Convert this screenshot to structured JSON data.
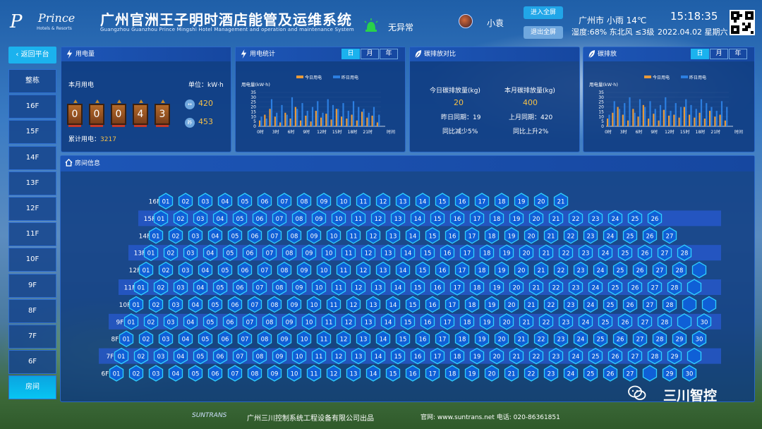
{
  "header": {
    "logo_mark": "P",
    "logo_brand": "Prince",
    "logo_sub": "Hotels & Resorts",
    "title": "广州官洲王子明时酒店能管及运维系统",
    "subtitle": "Guangzhou Guanzhou Prince Mingshi Hotel Management and operation and maintenance System",
    "status": "无异常",
    "username": "小袁",
    "enter_fullscreen": "进入全屏",
    "exit_fullscreen": "退出全屏",
    "weather_line1": "广州市 小雨 14℃",
    "weather_line2": "湿度:68% 东北风 ≤3级",
    "time": "15:18:35",
    "date": "2022.04.02 星期六"
  },
  "sidebar": {
    "back": "返回平台",
    "items": [
      "整栋",
      "16F",
      "15F",
      "14F",
      "13F",
      "12F",
      "11F",
      "10F",
      "9F",
      "8F",
      "7F",
      "6F",
      "房间"
    ],
    "active_index": 12
  },
  "power": {
    "title": "用电量",
    "month_label": "本月用电",
    "unit_label": "单位：kW·h",
    "digits": [
      "0",
      "0",
      "0",
      "4",
      "3"
    ],
    "total_label": "累计用电：",
    "total_value": "3217",
    "badge1": "↔",
    "badge2": "昨",
    "value1": "420",
    "value2": "453"
  },
  "stats": {
    "title": "用电统计",
    "tabs": [
      "日",
      "月",
      "年"
    ],
    "active_tab": 0
  },
  "carbon_compare": {
    "title": "碳排放对比",
    "today_label": "今日碳排放量(kg)",
    "month_label": "本月碳排放量(kg)",
    "today_value": "20",
    "month_value": "400",
    "yesterday_label": "昨日同期：19",
    "lastmonth_label": "上月同期：420",
    "yoy_down": "同比减少5%",
    "yoy_up": "同比上升2%"
  },
  "carbon": {
    "title": "碳排放",
    "tabs": [
      "日",
      "月",
      "年"
    ],
    "active_tab": 0
  },
  "chart_data": [
    {
      "type": "bar",
      "ylabel": "用电量(kW·h)",
      "xlabel": "时间",
      "ylim": [
        0,
        35
      ],
      "yticks": [
        "35",
        "30",
        "25",
        "20",
        "15",
        "10",
        "5",
        "0"
      ],
      "xticks": [
        "0时",
        "3时",
        "6时",
        "9时",
        "12时",
        "15时",
        "18时",
        "21时"
      ],
      "series": [
        {
          "name": "今日用电",
          "color": "#e89a3a",
          "values": [
            6,
            12,
            18,
            10,
            4,
            14,
            8,
            20,
            6,
            11,
            5,
            16,
            9,
            13,
            7,
            18,
            10,
            8,
            12,
            6,
            15,
            9,
            11,
            4
          ]
        },
        {
          "name": "昨日用电",
          "color": "#2c7ee0",
          "values": [
            10,
            8,
            28,
            14,
            22,
            12,
            30,
            18,
            24,
            16,
            20,
            26,
            14,
            28,
            22,
            18,
            24,
            16,
            26,
            20,
            18,
            14,
            20,
            12
          ]
        }
      ]
    },
    {
      "type": "bar",
      "ylabel": "用电量(kW·h)",
      "xlabel": "时间",
      "ylim": [
        0,
        35
      ],
      "yticks": [
        "35",
        "30",
        "25",
        "20",
        "15",
        "10",
        "5",
        "0"
      ],
      "xticks": [
        "0时",
        "3时",
        "6时",
        "9时",
        "12时",
        "15时",
        "18时",
        "21时"
      ],
      "series": [
        {
          "name": "今日用电",
          "color": "#e89a3a",
          "values": [
            8,
            14,
            20,
            12,
            6,
            18,
            10,
            22,
            8,
            13,
            6,
            17,
            11,
            12,
            9,
            20,
            12,
            9,
            14,
            8,
            16,
            10,
            12,
            6
          ]
        },
        {
          "name": "昨日用电",
          "color": "#2c7ee0",
          "values": [
            12,
            26,
            18,
            24,
            30,
            14,
            28,
            20,
            26,
            18,
            22,
            30,
            16,
            24,
            20,
            28,
            22,
            18,
            28,
            24,
            20,
            16,
            26,
            20
          ]
        }
      ]
    }
  ],
  "rooms": {
    "title": "房间信息",
    "floors": [
      {
        "label": "16F",
        "rooms": [
          "01",
          "02",
          "03",
          "04",
          "05",
          "06",
          "07",
          "08",
          "09",
          "10",
          "11",
          "12",
          "13",
          "14",
          "15",
          "16",
          "17",
          "18",
          "19",
          "20",
          "21"
        ]
      },
      {
        "label": "15F",
        "rooms": [
          "01",
          "02",
          "03",
          "04",
          "05",
          "06",
          "07",
          "08",
          "09",
          "10",
          "11",
          "12",
          "13",
          "14",
          "15",
          "16",
          "17",
          "18",
          "19",
          "20",
          "21",
          "22",
          "23",
          "24",
          "25",
          "26"
        ]
      },
      {
        "label": "14F",
        "rooms": [
          "01",
          "02",
          "03",
          "04",
          "05",
          "06",
          "07",
          "08",
          "09",
          "10",
          "11",
          "12",
          "13",
          "14",
          "15",
          "16",
          "17",
          "18",
          "19",
          "20",
          "21",
          "22",
          "23",
          "24",
          "25",
          "26",
          "27"
        ]
      },
      {
        "label": "13F",
        "rooms": [
          "01",
          "02",
          "03",
          "04",
          "05",
          "06",
          "07",
          "08",
          "09",
          "10",
          "11",
          "12",
          "13",
          "14",
          "15",
          "16",
          "17",
          "18",
          "19",
          "20",
          "21",
          "22",
          "23",
          "24",
          "25",
          "26",
          "27",
          "28"
        ]
      },
      {
        "label": "12F",
        "rooms": [
          "01",
          "02",
          "03",
          "04",
          "05",
          "06",
          "07",
          "08",
          "09",
          "10",
          "11",
          "12",
          "13",
          "14",
          "15",
          "16",
          "17",
          "18",
          "19",
          "20",
          "21",
          "22",
          "23",
          "24",
          "25",
          "26",
          "27",
          "28",
          ""
        ]
      },
      {
        "label": "11F",
        "rooms": [
          "01",
          "02",
          "03",
          "04",
          "05",
          "06",
          "07",
          "08",
          "09",
          "10",
          "11",
          "12",
          "13",
          "14",
          "15",
          "16",
          "17",
          "18",
          "19",
          "20",
          "21",
          "22",
          "23",
          "24",
          "25",
          "26",
          "27",
          "28",
          ""
        ]
      },
      {
        "label": "10F",
        "rooms": [
          "01",
          "02",
          "03",
          "04",
          "05",
          "06",
          "07",
          "08",
          "09",
          "10",
          "11",
          "12",
          "13",
          "14",
          "15",
          "16",
          "17",
          "18",
          "19",
          "20",
          "21",
          "22",
          "23",
          "24",
          "25",
          "26",
          "27",
          "28",
          "",
          ""
        ]
      },
      {
        "label": "9F",
        "rooms": [
          "01",
          "02",
          "03",
          "04",
          "05",
          "06",
          "07",
          "08",
          "09",
          "10",
          "11",
          "12",
          "13",
          "14",
          "15",
          "16",
          "17",
          "18",
          "19",
          "20",
          "21",
          "22",
          "23",
          "24",
          "25",
          "26",
          "27",
          "28",
          "",
          "30"
        ]
      },
      {
        "label": "8F",
        "rooms": [
          "01",
          "02",
          "03",
          "04",
          "05",
          "06",
          "07",
          "08",
          "09",
          "10",
          "11",
          "12",
          "13",
          "14",
          "15",
          "16",
          "17",
          "18",
          "19",
          "20",
          "21",
          "22",
          "23",
          "24",
          "25",
          "26",
          "27",
          "28",
          "29",
          "30"
        ]
      },
      {
        "label": "7F",
        "rooms": [
          "01",
          "02",
          "03",
          "04",
          "05",
          "06",
          "07",
          "08",
          "09",
          "10",
          "11",
          "12",
          "13",
          "14",
          "15",
          "16",
          "17",
          "18",
          "19",
          "20",
          "21",
          "22",
          "23",
          "24",
          "25",
          "26",
          "27",
          "28",
          "29",
          ""
        ]
      },
      {
        "label": "6F",
        "rooms": [
          "01",
          "02",
          "03",
          "04",
          "05",
          "06",
          "07",
          "08",
          "09",
          "10",
          "11",
          "12",
          "13",
          "14",
          "15",
          "16",
          "17",
          "18",
          "19",
          "20",
          "21",
          "22",
          "23",
          "24",
          "25",
          "26",
          "27",
          "",
          "29",
          "30"
        ]
      }
    ]
  },
  "footer": {
    "brand": "SUNTRANS",
    "company": "广州三川控制系统工程设备有限公司出品",
    "contact": "官网: www.suntrans.net  电话: 020-86361851"
  },
  "watermark": "三川智控"
}
